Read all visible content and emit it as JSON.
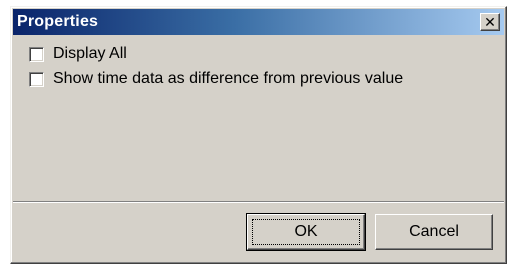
{
  "dialog": {
    "title": "Properties",
    "close_glyph": "✕",
    "close_icon": "close-icon"
  },
  "options": [
    {
      "label": "Display All",
      "checked": false
    },
    {
      "label": "Show time data as difference from previous value",
      "checked": false
    }
  ],
  "buttons": {
    "ok_label": "OK",
    "cancel_label": "Cancel"
  },
  "colors": {
    "title_gradient_start": "#0a246a",
    "title_gradient_end": "#a6caf0",
    "face": "#d5d1c9"
  }
}
